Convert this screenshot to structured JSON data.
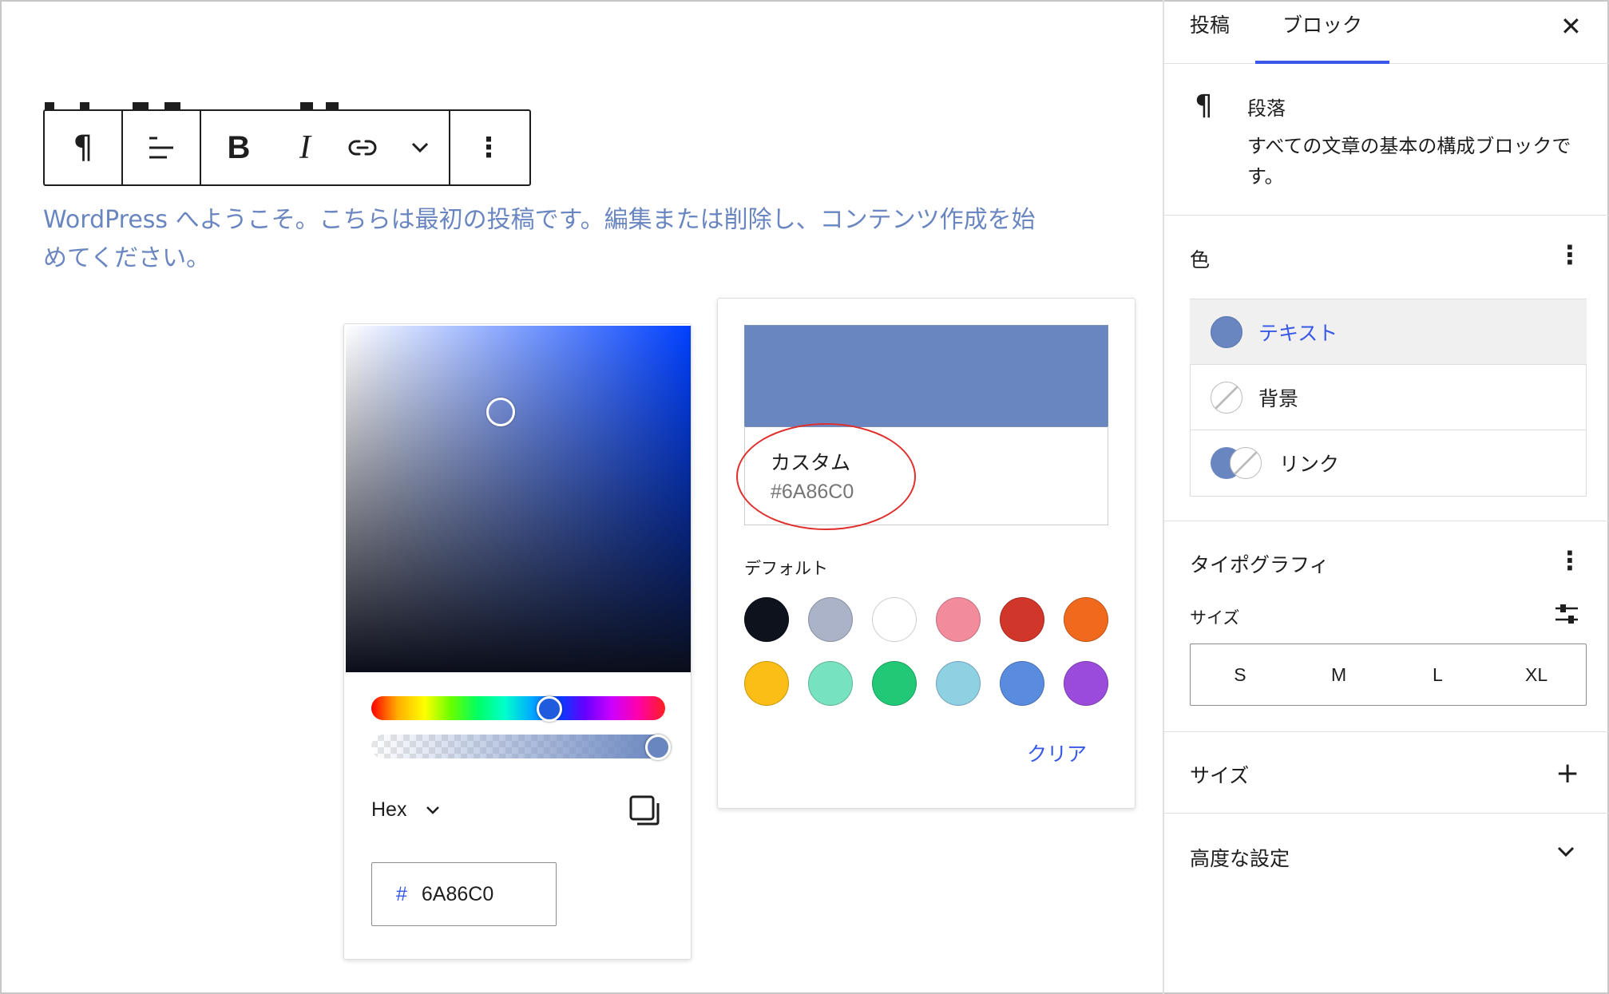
{
  "toolbar": {
    "paragraph_icon": "¶",
    "align_icon": "align-left-icon",
    "bold": "B",
    "italic": "I",
    "link_icon": "link-icon",
    "more_icon": "chevron-down-icon",
    "options_icon": "⋮"
  },
  "content": {
    "paragraph": "WordPress へようこそ。こちらは最初の投稿です。編集または削除し、コンテンツ作成を始めてください。"
  },
  "picker": {
    "format_label": "Hex",
    "hex_prefix": "#",
    "hex_value": "6A86C0",
    "copy_icon": "copy-icon"
  },
  "palette": {
    "current_color": "#6A86C0",
    "custom_label": "カスタム",
    "custom_hex": "#6A86C0",
    "default_label": "デフォルト",
    "clear_label": "クリア",
    "swatches": [
      "#0d121d",
      "#abb3c8",
      "#ffffff",
      "#f28b9c",
      "#d0362a",
      "#f0691c",
      "#fbbe16",
      "#76e2bf",
      "#21c875",
      "#8fd0e3",
      "#598cde",
      "#9a4bdc"
    ]
  },
  "sidebar": {
    "tab_post": "投稿",
    "tab_block": "ブロック",
    "close": "✕",
    "block_icon": "¶",
    "block_name": "段落",
    "block_desc": "すべての文章の基本の構成ブロックです。",
    "color_title": "色",
    "color_items": [
      "テキスト",
      "背景",
      "リンク"
    ],
    "typography_title": "タイポグラフィ",
    "size_label": "サイズ",
    "size_options": [
      "S",
      "M",
      "L",
      "XL"
    ],
    "size_panel_title": "サイズ",
    "advanced_title": "高度な設定",
    "kebab": "⋮",
    "plus": "+",
    "chevron": "⌄"
  }
}
